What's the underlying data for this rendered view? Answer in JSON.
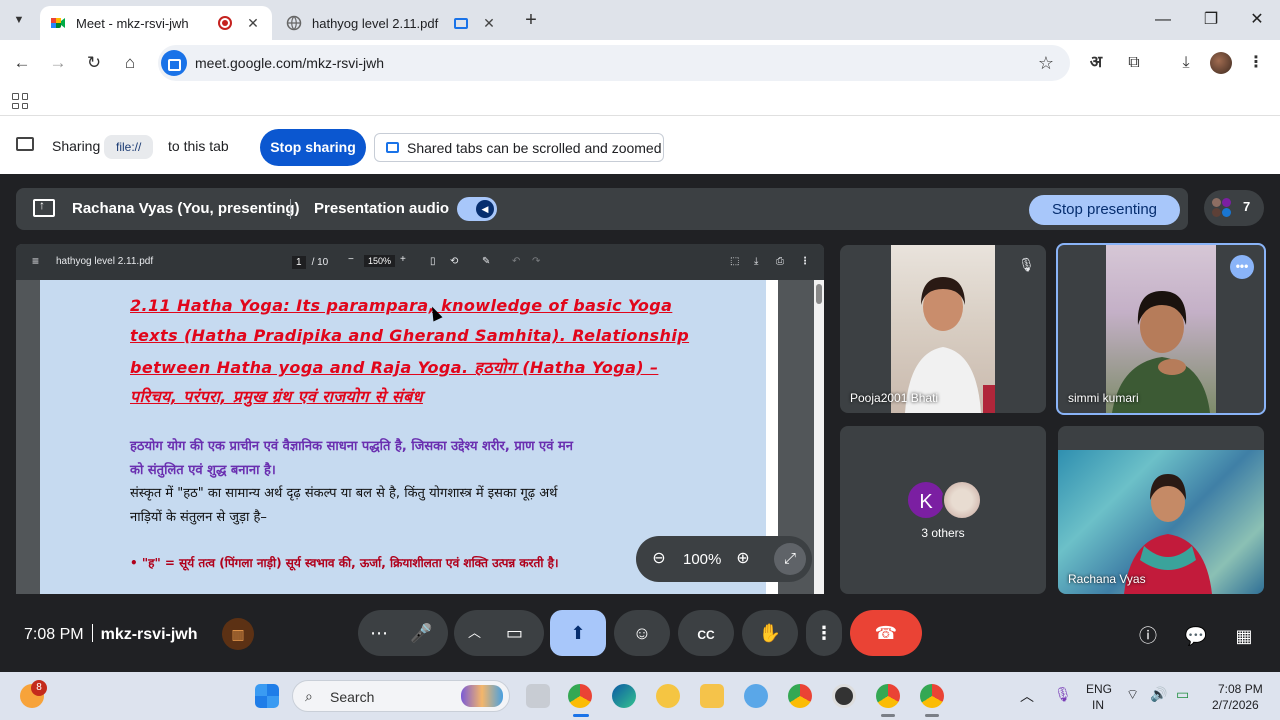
{
  "browser": {
    "tabs": [
      {
        "title": "Meet - mkz-rsvi-jwh",
        "active": true
      },
      {
        "title": "hathyog level 2.11.pdf",
        "active": false
      }
    ],
    "url": "meet.google.com/mkz-rsvi-jwh",
    "hindi_icon_label": "अ"
  },
  "sharing_bar": {
    "sharing_label": "Sharing",
    "file_chip": "file://",
    "to_tab_label": "to this tab",
    "stop_sharing": "Stop sharing",
    "scroll_notice": "Shared tabs can be scrolled and zoomed"
  },
  "presenting_bar": {
    "name": "Rachana Vyas (You, presenting)",
    "audio_label": "Presentation audio",
    "audio_enabled": true,
    "stop_presenting": "Stop presenting",
    "participant_count": "7"
  },
  "pdf": {
    "filename": "hathyog level 2.11.pdf",
    "page_current": "1",
    "page_total": "/ 10",
    "zoom": "150%",
    "heading_lines": [
      "2.11 Hatha Yoga: Its parampara, knowledge of basic Yoga",
      "texts (Hatha Pradipika and Gherand Samhita). Relationship",
      "between Hatha yoga and Raja Yoga. हठयोग (Hatha Yoga) –",
      "परिचय, परंपरा, प्रमुख ग्रंथ एवं राजयोग से संबंध"
    ],
    "purple_lines": [
      "हठयोग योग की एक प्राचीन एवं वैज्ञानिक साधना पद्धति है, जिसका उद्देश्य शरीर, प्राण एवं मन",
      "को संतुलित एवं शुद्ध बनाना है।"
    ],
    "black_lines": [
      "संस्कृत में \"हठ\" का सामान्य अर्थ दृढ़ संकल्प या बल से है, किंतु योगशास्त्र में इसका गूढ़ अर्थ",
      "नाड़ियों के संतुलन से जुड़ा है–"
    ],
    "bullet_line": "• \"ह\" = सूर्य तत्व (पिंगला नाड़ी)  सूर्य स्वभाव की, ऊर्जा, क्रियाशीलता एवं शक्ति उत्पन्न करती है।"
  },
  "zoom_control": {
    "value": "100%"
  },
  "participants": [
    {
      "name": "Pooja2001 Bhati",
      "muted": true
    },
    {
      "name": "simmi kumari",
      "muted": false
    },
    {
      "avatar_letter": "K",
      "label": "3 others"
    },
    {
      "name": "Rachana Vyas"
    }
  ],
  "meeting_info": {
    "time": "7:08 PM",
    "meeting_id": "mkz-rsvi-jwh"
  },
  "taskbar": {
    "notification_badge": "8",
    "search_label": "Search",
    "language": "ENG",
    "region": "IN",
    "time": "7:08 PM",
    "date": "2/7/2026"
  },
  "colors": {
    "meet_bg": "#202124",
    "control_bg": "#3c4043",
    "accent_blue": "#a8c7fa",
    "end_call_red": "#ea4335",
    "stop_sharing_blue": "#0b57d0",
    "pdf_heading_red": "#e1061b",
    "pdf_purple": "#6a2fb0"
  }
}
